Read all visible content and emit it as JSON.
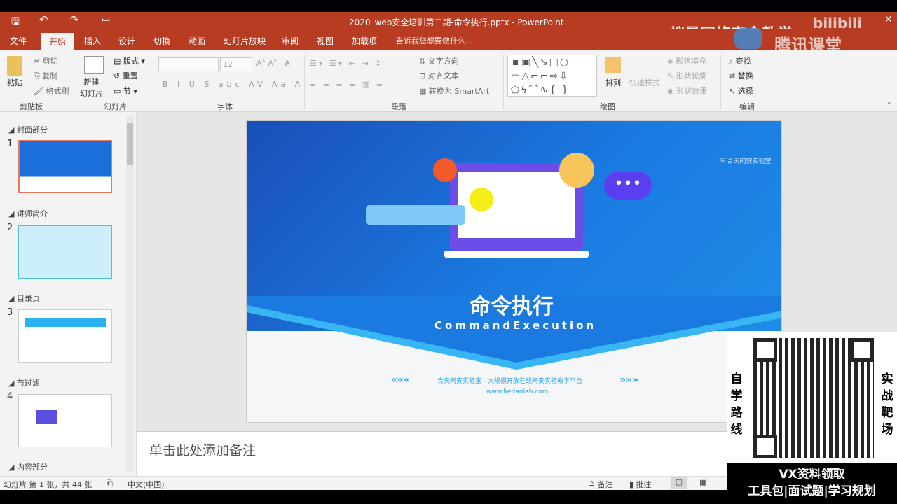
{
  "titlebar": {
    "title": "2020_web安全培训第二期-命令执行.pptx - PowerPoint",
    "watermark": "蚁景网络安全教学",
    "watermark2": "腾讯课堂",
    "watermark3": "bilibili"
  },
  "tabs": [
    {
      "label": "文件"
    },
    {
      "label": "开始"
    },
    {
      "label": "插入"
    },
    {
      "label": "设计"
    },
    {
      "label": "切换"
    },
    {
      "label": "动画"
    },
    {
      "label": "幻灯片放映"
    },
    {
      "label": "审阅"
    },
    {
      "label": "视图"
    },
    {
      "label": "加载项"
    }
  ],
  "tell_me": "告诉我您想要做什么...",
  "ribbon": {
    "clipboard": {
      "paste": "粘贴",
      "cut": "剪切",
      "copy": "复制",
      "format_painter": "格式刷",
      "group": "剪贴板"
    },
    "slides": {
      "new_slide": "新建\n幻灯片",
      "layout": "版式",
      "reset": "重置",
      "section": "节",
      "group": "幻灯片"
    },
    "font": {
      "size": "12",
      "group": "字体"
    },
    "paragraph": {
      "text_direction": "文字方向",
      "align_text": "对齐文本",
      "smartart": "转换为 SmartArt",
      "group": "段落"
    },
    "drawing": {
      "arrange": "排列",
      "quick_styles": "快速样式",
      "fill": "形状填充",
      "outline": "形状轮廓",
      "effects": "形状效果",
      "group": "绘图"
    },
    "editing": {
      "find": "查找",
      "replace": "替换",
      "select": "选择",
      "group": "编辑"
    }
  },
  "sections": [
    {
      "label": "封面部分",
      "num": "1"
    },
    {
      "label": "讲师简介",
      "num": "2"
    },
    {
      "label": "目录页",
      "num": "3"
    },
    {
      "label": "节过滤",
      "num": "4"
    },
    {
      "label": "内容部分"
    }
  ],
  "slide": {
    "title": "命令执行",
    "subtitle": "CommandExecution",
    "tagline": "合天网安实验室 - 大规模开放在线网安实验教学平台",
    "url": "www.hetianlab.com",
    "logo": "合天网安实验室",
    "left_arrows": "«««",
    "right_arrows": "»»»"
  },
  "notes": {
    "placeholder": "单击此处添加备注"
  },
  "status": {
    "slide_info": "幻灯片 第 1 张，共 44 张",
    "language": "中文(中国)",
    "notes": "备注",
    "comments": "批注"
  },
  "overlay": {
    "left_vertical": "自学路线",
    "right_vertical": "实战靶场",
    "line1": "VX资料领取",
    "line2": "工具包|面试题|学习规划"
  },
  "colors": {
    "accent": "#b83c22",
    "slide_blue": "#1a6fd8"
  }
}
